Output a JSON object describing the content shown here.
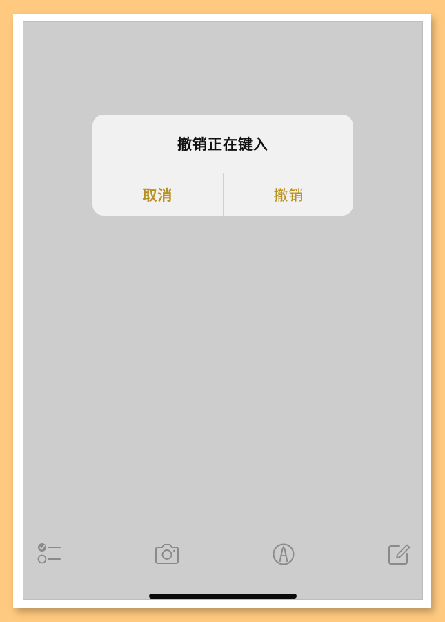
{
  "alert": {
    "title": "撤销正在键入",
    "cancel_label": "取消",
    "undo_label": "撤销"
  },
  "toolbar": {
    "icons": [
      "checklist-icon",
      "camera-icon",
      "markup-icon",
      "compose-icon"
    ]
  },
  "colors": {
    "accent": "#b8901e",
    "screen_bg": "#cdcdcd",
    "alert_bg": "#f1f1f1",
    "icon": "#8a8a8a"
  }
}
